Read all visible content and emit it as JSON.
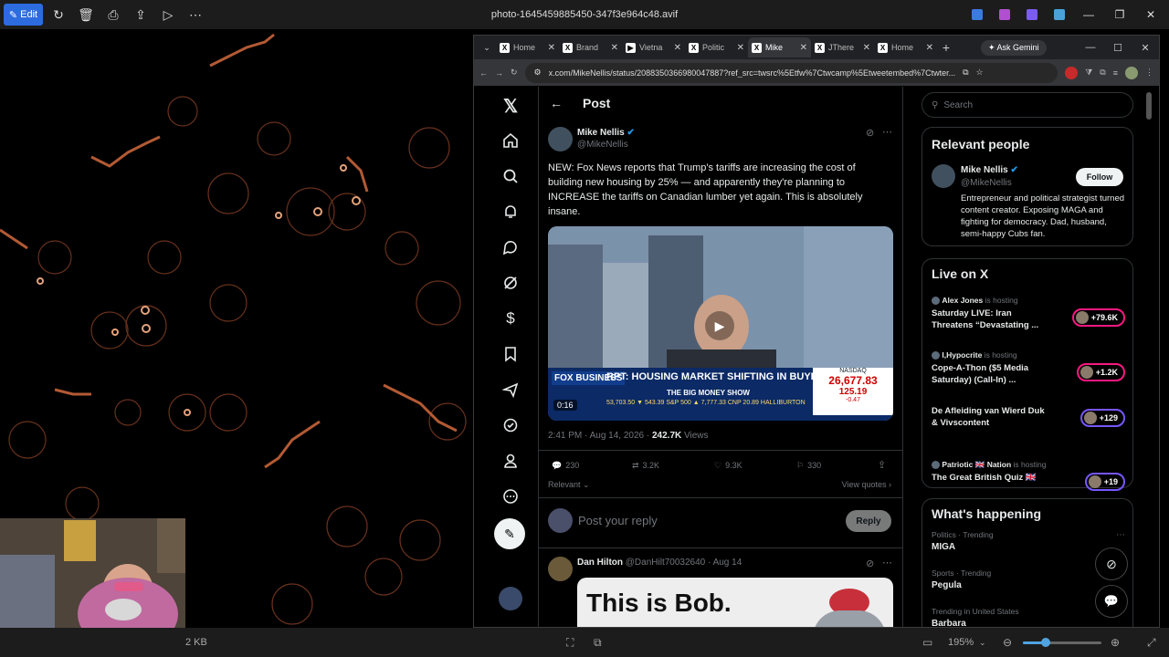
{
  "viewer": {
    "edit_label": "Edit",
    "title": "photo-1645459885450-347f3e964c48.avif",
    "file_size": "2 KB",
    "zoom": "195%"
  },
  "browser": {
    "tabs": [
      {
        "label": "Home",
        "icon": "X",
        "active": false
      },
      {
        "label": "Brand",
        "icon": "X",
        "active": false
      },
      {
        "label": "Vietna",
        "icon": "▶",
        "active": false
      },
      {
        "label": "Politic",
        "icon": "X",
        "active": false
      },
      {
        "label": "Mike",
        "icon": "X",
        "active": true
      },
      {
        "label": "JThere",
        "icon": "X",
        "active": false
      },
      {
        "label": "Home",
        "icon": "X",
        "active": false
      }
    ],
    "gemini_label": "Ask Gemini",
    "url": "x.com/MikeNellis/status/2088350366980047887?ref_src=twsrc%5Etfw%7Ctwcamp%5Etweetembed%7Ctwter..."
  },
  "header": {
    "title": "Post"
  },
  "post": {
    "author_name": "Mike Nellis",
    "author_handle": "@MikeNellis",
    "text": "NEW: Fox News reports that Trump's tariffs are increasing the cost of building new housing by 25% — and apparently they're planning to INCREASE the tariffs on Canadian lumber yet again. This is absolutely insane.",
    "video": {
      "duration": "0:16",
      "ticker_headline": "RPT: HOUSING MARKET SHIFTING IN BUYERS' FAVOR",
      "show": "THE BIG MONEY SHOW",
      "index_name": "NASDAQ",
      "index_value": "26,677.83",
      "index_change": "125.19",
      "index_pct": "-0.47",
      "network": "FOX BUSINESS",
      "ticker_line": "53,703.50 ▼ 543.39  S&P 500 ▲ 7,777.33  CNP 20.89  HALLIBURTON"
    },
    "time": "2:41 PM",
    "date": "Aug 14, 2026",
    "views": "242.7K",
    "views_label": "Views",
    "replies": "230",
    "reposts": "3.2K",
    "likes": "9.3K",
    "bookmarks": "330",
    "relevant_label": "Relevant",
    "view_quotes": "View quotes"
  },
  "reply": {
    "placeholder": "Post your reply",
    "button": "Reply"
  },
  "comment": {
    "name": "Dan Hilton",
    "handle": "@DanHilt70032640",
    "date": "Aug 14",
    "image_text": "This is Bob."
  },
  "search": {
    "placeholder": "Search"
  },
  "relevant": {
    "title": "Relevant people",
    "name": "Mike Nellis",
    "handle": "@MikeNellis",
    "follow": "Follow",
    "bio": "Entrepreneur and political strategist turned content creator. Exposing MAGA and fighting for democracy. Dad, husband, semi-happy Cubs fan."
  },
  "live": {
    "title": "Live on X",
    "items": [
      {
        "host": "Alex Jones",
        "status": "is hosting",
        "title": "Saturday LIVE: Iran Threatens “Devastating ...",
        "count": "+79.6K"
      },
      {
        "host": "I,Hypocrite",
        "status": "is hosting",
        "title": "Cope-A-Thon ($5 Media Saturday) (Call-In) ...",
        "count": "+1.2K"
      },
      {
        "host": "",
        "status": "",
        "title": "De Afleiding van Wierd Duk & Vivscontent",
        "count": "+129"
      },
      {
        "host": "Patriotic 🇬🇧 Nation",
        "status": "is hosting",
        "title": "The Great British Quiz 🇬🇧",
        "count": "+19"
      }
    ]
  },
  "happening": {
    "title": "What's happening",
    "items": [
      {
        "context": "Politics · Trending",
        "topic": "MIGA"
      },
      {
        "context": "Sports · Trending",
        "topic": "Pegula"
      },
      {
        "context": "Trending in United States",
        "topic": "Barbara"
      }
    ]
  }
}
